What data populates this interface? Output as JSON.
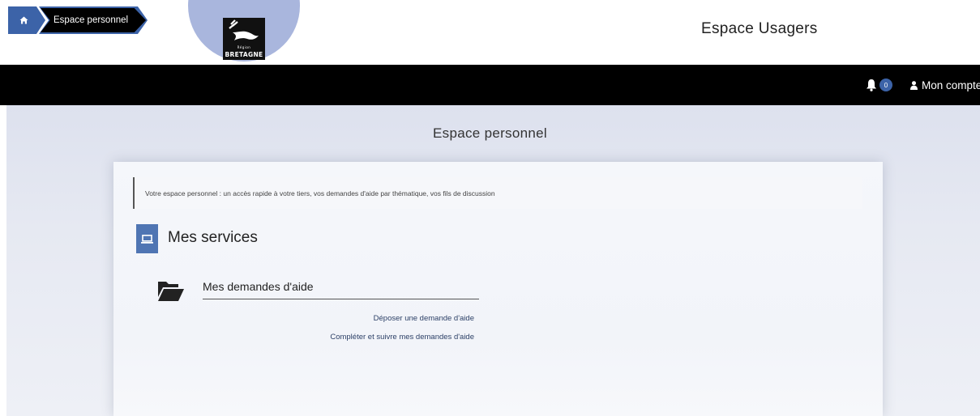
{
  "header": {
    "logo": {
      "region_text": "Région",
      "name_text": "BRETAGNE"
    },
    "site_title": "Espace Usagers"
  },
  "navbar": {
    "breadcrumb": {
      "current_label": "Espace personnel"
    },
    "notifications": {
      "count": "0"
    },
    "account_label": "Mon compte"
  },
  "main": {
    "page_title": "Espace personnel",
    "intro_text": "Votre espace personnel : un accès rapide à votre tiers, vos demandes d'aide par thématique, vos fils de discussion",
    "services": {
      "title": "Mes services",
      "demandes": {
        "title": "Mes demandes d'aide",
        "links": [
          {
            "label": "Déposer une demande d'aide"
          },
          {
            "label": "Compléter et suivre mes demandes d'aide"
          }
        ]
      }
    }
  },
  "colors": {
    "accent": "#3c63a8",
    "navbar_bg": "#000000",
    "logo_circle": "#a9b6dd",
    "services_icon_bg": "#4f75b3"
  },
  "icons": [
    "home-icon",
    "bell-icon",
    "user-icon",
    "laptop-icon",
    "folder-open-icon"
  ]
}
